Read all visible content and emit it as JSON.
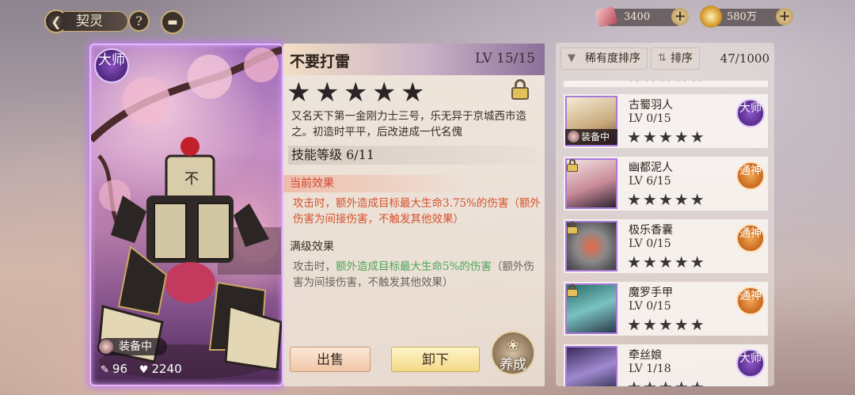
{
  "header": {
    "back_icon": "back-arrow-icon",
    "title": "契灵",
    "help_label": "?",
    "chat_icon": "chat-bubble-icon"
  },
  "currencies": [
    {
      "icon": "ticket-icon",
      "value": "3400"
    },
    {
      "icon": "gold-coin-icon",
      "value": "580万"
    }
  ],
  "card": {
    "rank": "大师",
    "equip_label": "装备中",
    "attack": "96",
    "health": "2240"
  },
  "detail": {
    "name": "不要打雷",
    "level": "LV 15/15",
    "stars": 5,
    "description": "又名天下第一金刚力士三号，乐无异于京城西市造之。初造时平平，后改进成一代名傀",
    "skill_level": "技能等级 6/11",
    "current_effect_title": "当前效果",
    "current_effect_prefix": "攻击时，",
    "current_effect_main": "额外造成目标最大生命3.75%的伤害（额外伤害为间接伤害，不触发其他效果）",
    "max_effect_title": "满级效果",
    "max_effect_prefix": "攻击时，",
    "max_effect_highlight": "额外造成目标最大生命5%的伤害",
    "max_effect_suffix": "（额外伤害为间接伤害，不触发其他效果）",
    "sell_label": "出售",
    "unload_label": "卸下",
    "nurture_label": "养成"
  },
  "list": {
    "sort_rarity_label": "稀有度排序",
    "sort_order_label": "排序",
    "count": "47/1000",
    "items": [
      {
        "name": "古蜀羽人",
        "level": "LV 0/15",
        "rank": "大师",
        "rank_type": "ds",
        "locked": false,
        "equipped": true,
        "equip_label": "装备中"
      },
      {
        "name": "幽都泥人",
        "level": "LV 6/15",
        "rank": "通神",
        "rank_type": "ts",
        "locked": true,
        "equipped": false
      },
      {
        "name": "极乐香囊",
        "level": "LV 0/15",
        "rank": "通神",
        "rank_type": "ts",
        "locked": true,
        "equipped": false
      },
      {
        "name": "魔罗手甲",
        "level": "LV 0/15",
        "rank": "通神",
        "rank_type": "ts",
        "locked": true,
        "equipped": false
      },
      {
        "name": "牵丝娘",
        "level": "LV 1/18",
        "rank": "大师",
        "rank_type": "ds",
        "locked": false,
        "equipped": false
      }
    ]
  },
  "colors": {
    "accent_gold": "#c9ad73",
    "current_effect": "#d4512c",
    "highlight_green": "#3aa54c",
    "rank_master": "#6a3aa0",
    "rank_divine": "#d9781f"
  }
}
